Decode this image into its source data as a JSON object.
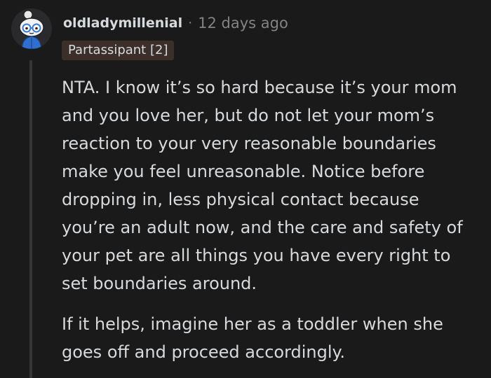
{
  "comment": {
    "username": "oldladymillenial",
    "separator": "·",
    "timestamp": "12 days ago",
    "flair": "Partassipant [2]",
    "paragraphs": [
      {
        "lines": [
          "NTA. I know it’s so hard because it’s your mom",
          "and you love her, but do not let your mom’s",
          "reaction to your very reasonable boundaries",
          "make you feel unreasonable. Notice before",
          "dropping in, less physical contact because",
          "you’re an adult now, and the care and safety of",
          "your pet are all things you have every right to",
          "set boundaries around."
        ]
      },
      {
        "lines": [
          "If it helps, imagine her as a toddler when she",
          "goes off and proceed accordingly."
        ]
      }
    ]
  },
  "colors": {
    "background": "#1a1a1b",
    "text": "#d7dadc",
    "meta": "#818384",
    "flair_bg": "#3a2f2b",
    "thread_line": "#343536"
  },
  "icons": {
    "avatar": "snoo-avatar-icon"
  }
}
